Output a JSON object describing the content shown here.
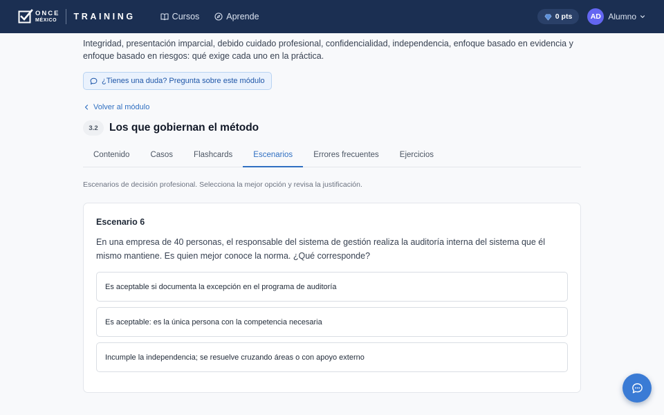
{
  "header": {
    "logo_line1": "ONCE",
    "logo_line2": "MÉXICO",
    "brand_title": "TRAINING",
    "nav": [
      {
        "label": "Cursos",
        "icon": "book-icon"
      },
      {
        "label": "Aprende",
        "icon": "compass-icon"
      }
    ],
    "points_label": "0 pts",
    "avatar_initials": "AD",
    "user_name": "Alumno"
  },
  "intro_text": "Integridad, presentación imparcial, debido cuidado profesional, confidencialidad, independencia, enfoque basado en evidencia y enfoque basado en riesgos: qué exige cada uno en la práctica.",
  "ask_button_label": "¿Tienes una duda? Pregunta sobre este módulo",
  "back_link_label": "Volver al módulo",
  "lesson": {
    "number": "3.2",
    "title": "Los que gobiernan el método"
  },
  "tabs": [
    {
      "label": "Contenido",
      "active": false
    },
    {
      "label": "Casos",
      "active": false
    },
    {
      "label": "Flashcards",
      "active": false
    },
    {
      "label": "Escenarios",
      "active": true
    },
    {
      "label": "Errores frecuentes",
      "active": false
    },
    {
      "label": "Ejercicios",
      "active": false
    }
  ],
  "tab_description": "Escenarios de decisión profesional. Selecciona la mejor opción y revisa la justificación.",
  "scenario": {
    "title": "Escenario 6",
    "question": "En una empresa de 40 personas, el responsable del sistema de gestión realiza la auditoría interna del sistema que él mismo mantiene. Es quien mejor conoce la norma. ¿Qué corresponde?",
    "options": [
      "Es aceptable si documenta la excepción en el programa de auditoría",
      "Es aceptable: es la única persona con la competencia necesaria",
      "Incumple la independencia; se resuelve cruzando áreas o con apoyo externo"
    ]
  },
  "colors": {
    "header_bg": "#1b2f52",
    "accent": "#2f6fc1",
    "avatar_bg": "#6366f1",
    "fab_bg": "#3a7bd5"
  }
}
